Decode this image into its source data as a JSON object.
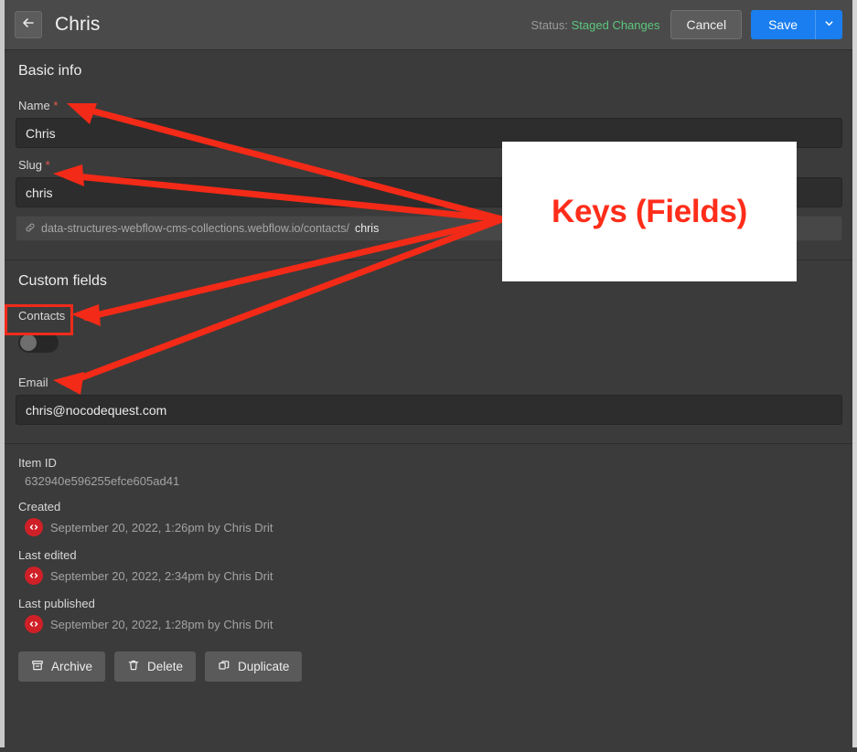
{
  "topbar": {
    "back_icon": "arrow-left-icon",
    "title": "Chris",
    "status_label": "Status:",
    "status_value": "Staged Changes",
    "cancel_label": "Cancel",
    "save_label": "Save",
    "save_caret_icon": "chevron-down-icon"
  },
  "basic_info": {
    "heading": "Basic info",
    "name_label": "Name",
    "name_required": "*",
    "name_value": "Chris",
    "slug_label": "Slug",
    "slug_required": "*",
    "slug_value": "chris",
    "url_icon": "link-icon",
    "url_base": "data-structures-webflow-cms-collections.webflow.io/contacts/",
    "url_slug": "chris"
  },
  "custom_fields": {
    "heading": "Custom fields",
    "contacts_label": "Contacts",
    "contacts_toggle_state": "off",
    "email_label": "Email",
    "email_value": "chris@nocodequest.com"
  },
  "meta": {
    "item_id_label": "Item ID",
    "item_id_value": "632940e596255efce605ad41",
    "created_label": "Created",
    "created_value": "September 20, 2022, 1:26pm by Chris Drit",
    "created_icon": "code-badge-icon",
    "last_edited_label": "Last edited",
    "last_edited_value": "September 20, 2022, 2:34pm by Chris Drit",
    "last_edited_icon": "code-badge-icon",
    "last_published_label": "Last published",
    "last_published_value": "September 20, 2022, 1:28pm by Chris Drit",
    "last_published_icon": "code-badge-icon"
  },
  "actions": {
    "archive_label": "Archive",
    "archive_icon": "archive-box-icon",
    "delete_label": "Delete",
    "delete_icon": "trash-icon",
    "duplicate_label": "Duplicate",
    "duplicate_icon": "copy-icon"
  },
  "annotation": {
    "callout_text": "Keys (Fields)",
    "accent_color": "#ff2d1a"
  }
}
